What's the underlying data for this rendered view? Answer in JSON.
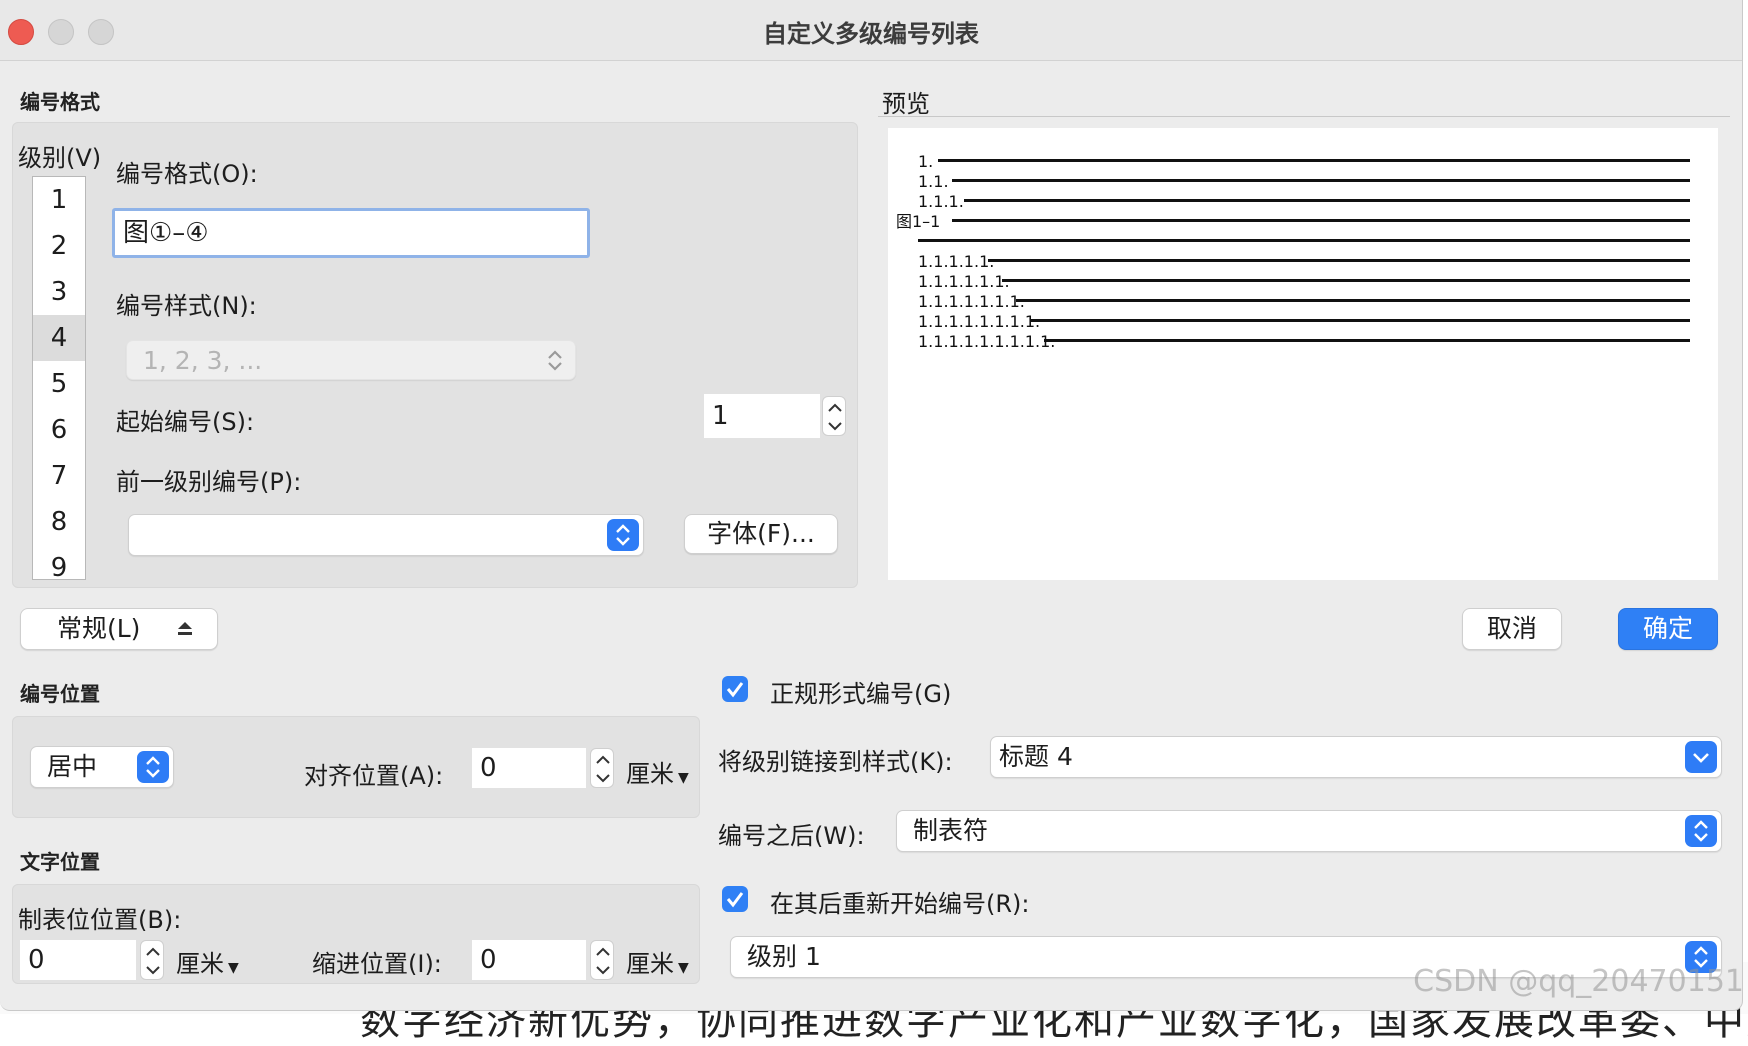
{
  "window": {
    "title": "自定义多级编号列表"
  },
  "number_format_section": {
    "heading": "编号格式",
    "level_label": "级别(V)",
    "levels": [
      "1",
      "2",
      "3",
      "4",
      "5",
      "6",
      "7",
      "8",
      "9"
    ],
    "selected_level_index": 3,
    "format_label": "编号格式(O):",
    "format_value": "图①–④",
    "style_label": "编号样式(N):",
    "style_value": "1, 2, 3, ...",
    "start_label": "起始编号(S):",
    "start_value": "1",
    "prev_level_label": "前一级别编号(P):",
    "prev_level_value": "",
    "font_button": "字体(F)..."
  },
  "preview": {
    "heading": "预览",
    "rows": [
      "1.",
      "1.1.",
      "1.1.1.",
      "图1–1",
      "",
      "1.1.1.1.1.",
      "1.1.1.1.1.1.",
      "1.1.1.1.1.1.1.",
      "1.1.1.1.1.1.1.1.",
      "1.1.1.1.1.1.1.1.1."
    ]
  },
  "buttons": {
    "more_toggle": "常规(L)",
    "cancel": "取消",
    "ok": "确定"
  },
  "number_position": {
    "heading": "编号位置",
    "alignment_value": "居中",
    "align_at_label": "对齐位置(A):",
    "align_at_value": "0",
    "unit": "厘米"
  },
  "text_position": {
    "heading": "文字位置",
    "tab_stop_label": "制表位位置(B):",
    "tab_stop_value": "0",
    "tab_unit": "厘米",
    "indent_label": "缩进位置(I):",
    "indent_value": "0",
    "indent_unit": "厘米"
  },
  "right_options": {
    "legal_style_label": "正规形式编号(G)",
    "legal_style_checked": true,
    "link_style_label": "将级别链接到样式(K):",
    "link_style_value": "标题 4",
    "follow_number_label": "编号之后(W):",
    "follow_number_value": "制表符",
    "restart_label": "在其后重新开始编号(R):",
    "restart_checked": true,
    "restart_value": "级别 1"
  },
  "background_text": {
    "bottom_line": "数字经济新优势，协同推进数字产业化和产业数字化，国家发展改革委、中央网",
    "watermark": "CSDN @qq_20470151"
  },
  "colors": {
    "accent": "#2f80f5",
    "window_bg": "#ececec",
    "close": "#ee5b52"
  }
}
